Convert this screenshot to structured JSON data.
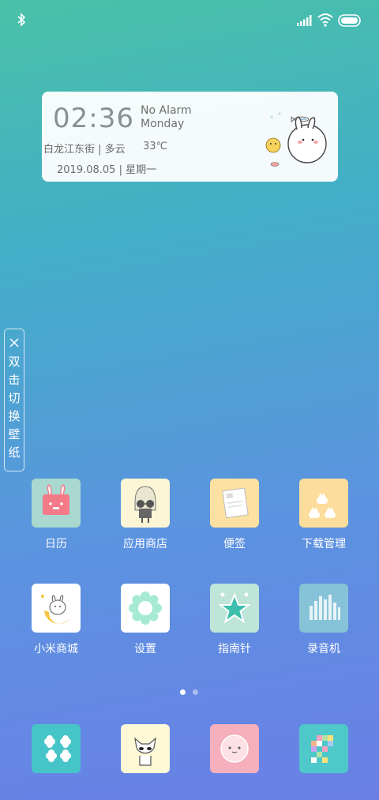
{
  "widget": {
    "time": "02:36",
    "alarm": "No Alarm",
    "day": "Monday",
    "location_weather": "白龙江东街 | 多云",
    "temperature": "33℃",
    "date": "2019.08.05 | 星期一"
  },
  "wallpaper_hint": {
    "chars": [
      "双",
      "击",
      "切",
      "换",
      "壁",
      "纸"
    ]
  },
  "apps_row1": [
    {
      "label": "日历",
      "color": "#a8d8cf",
      "icon": "calendar-icon"
    },
    {
      "label": "应用商店",
      "color": "#fcf6d6",
      "icon": "app-store-icon"
    },
    {
      "label": "便签",
      "color": "#fde1a2",
      "icon": "notes-icon"
    },
    {
      "label": "下载管理",
      "color": "#fddd9b",
      "icon": "download-icon"
    }
  ],
  "apps_row2": [
    {
      "label": "小米商城",
      "color": "#ffffff",
      "icon": "mi-store-icon"
    },
    {
      "label": "设置",
      "color": "#ffffff",
      "icon": "settings-icon"
    },
    {
      "label": "指南针",
      "color": "#bfe4d8",
      "icon": "compass-icon"
    },
    {
      "label": "录音机",
      "color": "#86c3d8",
      "icon": "recorder-icon"
    }
  ],
  "dock": [
    {
      "color": "#46c5c9",
      "icon": "flower-icon"
    },
    {
      "color": "#fdf8d6",
      "icon": "cat-icon"
    },
    {
      "color": "#f6b0bd",
      "icon": "face-icon"
    },
    {
      "color": "#4ec8c9",
      "icon": "pixel-icon"
    }
  ],
  "page_indicator": {
    "count": 2,
    "active": 0
  }
}
